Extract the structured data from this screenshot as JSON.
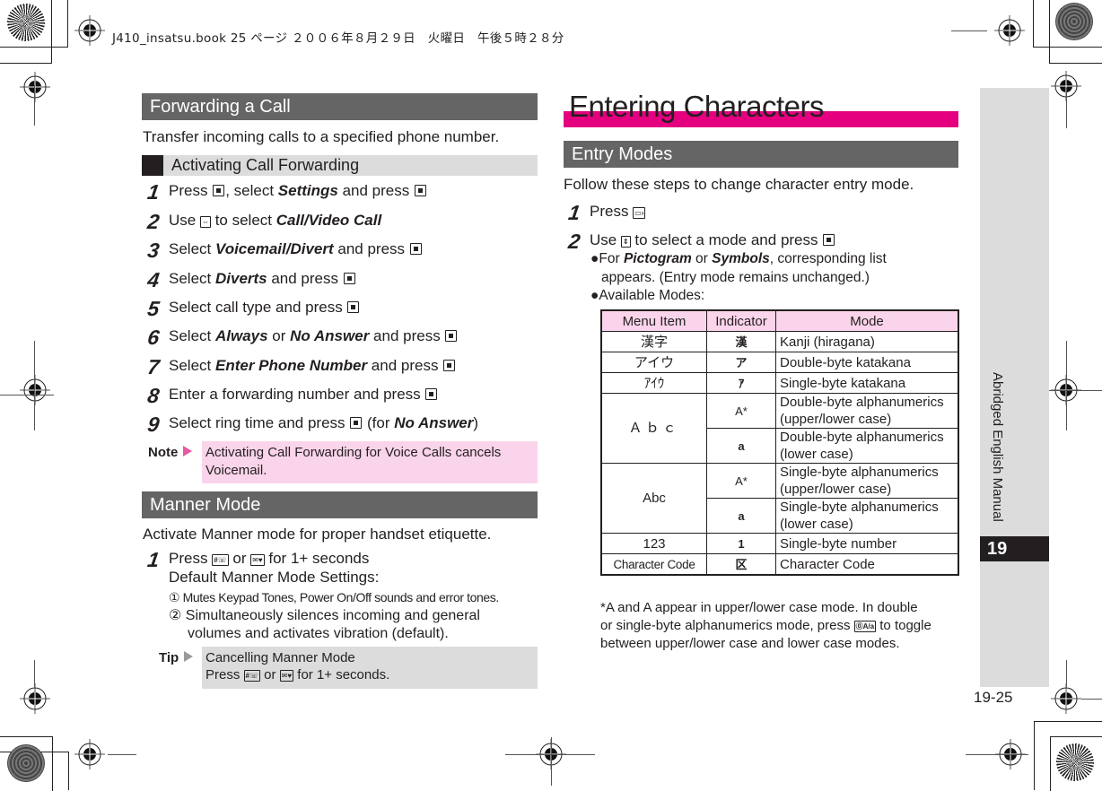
{
  "print_header": "J410_insatsu.book  25 ページ  ２００６年８月２９日　火曜日　午後５時２８分",
  "left": {
    "forwarding": {
      "title": "Forwarding a Call",
      "intro": "Transfer incoming calls to a specified phone number.",
      "subsection": "Activating Call Forwarding",
      "steps": [
        {
          "num": "1",
          "parts": [
            [
              "t",
              "Press "
            ],
            [
              "k",
              ""
            ],
            [
              "t",
              ", select "
            ],
            [
              "b",
              "Settings"
            ],
            [
              "t",
              " and press "
            ],
            [
              "k",
              ""
            ]
          ]
        },
        {
          "num": "2",
          "parts": [
            [
              "t",
              "Use "
            ],
            [
              "nav",
              ""
            ],
            [
              "t",
              " to select "
            ],
            [
              "b",
              "Call/Video Call"
            ]
          ]
        },
        {
          "num": "3",
          "parts": [
            [
              "t",
              "Select "
            ],
            [
              "b",
              "Voicemail/Divert"
            ],
            [
              "t",
              " and press "
            ],
            [
              "k",
              ""
            ]
          ]
        },
        {
          "num": "4",
          "parts": [
            [
              "t",
              "Select "
            ],
            [
              "b",
              "Diverts"
            ],
            [
              "t",
              " and press "
            ],
            [
              "k",
              ""
            ]
          ]
        },
        {
          "num": "5",
          "parts": [
            [
              "t",
              "Select call type and press "
            ],
            [
              "k",
              ""
            ]
          ]
        },
        {
          "num": "6",
          "parts": [
            [
              "t",
              "Select "
            ],
            [
              "b",
              "Always"
            ],
            [
              "t",
              " or "
            ],
            [
              "b",
              "No Answer"
            ],
            [
              "t",
              " and press "
            ],
            [
              "k",
              ""
            ]
          ]
        },
        {
          "num": "7",
          "parts": [
            [
              "t",
              "Select "
            ],
            [
              "b",
              "Enter Phone Number"
            ],
            [
              "t",
              " and press "
            ],
            [
              "k",
              ""
            ]
          ]
        },
        {
          "num": "8",
          "parts": [
            [
              "t",
              "Enter a forwarding number and press "
            ],
            [
              "k",
              ""
            ]
          ]
        },
        {
          "num": "9",
          "parts": [
            [
              "t",
              "Select ring time and press "
            ],
            [
              "k",
              ""
            ],
            [
              "t",
              " (for "
            ],
            [
              "b",
              "No Answer"
            ],
            [
              "t",
              ")"
            ]
          ]
        }
      ],
      "note_label": "Note",
      "note_text": "Activating Call Forwarding for Voice Calls cancels Voicemail."
    },
    "manner": {
      "title": "Manner Mode",
      "intro": "Activate Manner mode for proper handset etiquette.",
      "step_num": "1",
      "step_line1_a": "Press ",
      "step_key1": "#",
      "step_line1_b": " or ",
      "step_key2": "✉",
      "step_line1_c": " for 1+ seconds",
      "step_line2": "Default Manner Mode Settings:",
      "setting1": "① Mutes Keypad Tones, Power On/Off sounds and error tones.",
      "setting2_a": "② Simultaneously silences incoming and general",
      "setting2_b": "volumes and activates vibration (default).",
      "tip_label": "Tip",
      "tip_title": "Cancelling Manner Mode",
      "tip_text_a": "Press ",
      "tip_text_b": " or ",
      "tip_text_c": " for 1+ seconds."
    }
  },
  "right": {
    "chapter_title": "Entering Characters",
    "section_title": "Entry Modes",
    "intro": "Follow these steps to change character entry mode.",
    "step1_num": "1",
    "step1_text": "Press ",
    "step1_key": "▭›",
    "step2_num": "2",
    "step2_a": "Use ",
    "step2_b": " to select a mode and press ",
    "bullet1_a": "For ",
    "bullet1_b1": "Pictogram",
    "bullet1_c": " or ",
    "bullet1_b2": "Symbols",
    "bullet1_d": ", corresponding list",
    "bullet1_e": "appears. (Entry mode remains unchanged.)",
    "bullet2": "Available Modes:",
    "table": {
      "headers": [
        "Menu Item",
        "Indicator",
        "Mode"
      ],
      "rows": [
        {
          "item": "漢字",
          "indicator": "漢",
          "mode": "Kanji (hiragana)"
        },
        {
          "item": "アイウ",
          "indicator": "ア",
          "mode": "Double-byte katakana"
        },
        {
          "item": "ｱｲｳ",
          "indicator": "ｱ",
          "mode": "Single-byte katakana"
        },
        {
          "item": "Ａｂｃ",
          "indicator": "A*",
          "mode": "Double-byte alphanumerics (upper/lower case)"
        },
        {
          "item": "",
          "indicator": "a",
          "mode": "Double-byte alphanumerics (lower case)"
        },
        {
          "item": "Abc",
          "indicator": "A*",
          "mode": "Single-byte alphanumerics (upper/lower case)"
        },
        {
          "item": "",
          "indicator": "a",
          "mode": "Single-byte alphanumerics (lower case)"
        },
        {
          "item": "123",
          "indicator": "1",
          "mode": "Single-byte number"
        },
        {
          "item": "Character Code",
          "indicator": "区",
          "mode": "Character Code"
        }
      ]
    },
    "footnote_1": "*A  and  A  appear in upper/lower case mode. In double",
    "footnote_2": " or single-byte alphanumerics mode, press ",
    "footnote_2b": " to toggle",
    "footnote_3": " between upper/lower case and lower case modes."
  },
  "side": {
    "label": "Abridged English Manual",
    "chapter": "19"
  },
  "page_number": "19-25",
  "colors": {
    "section_bar": "#666566",
    "subsection_bar": "#dcdcdc",
    "accent_pink": "#e4007f",
    "note_pink": "#fad4ea"
  }
}
